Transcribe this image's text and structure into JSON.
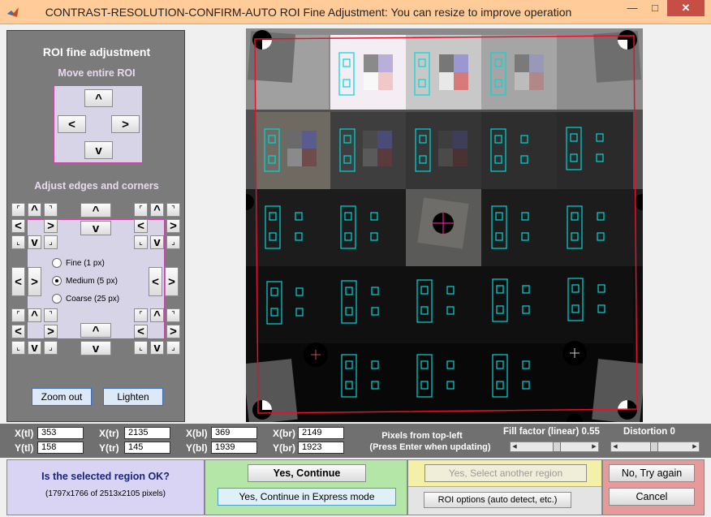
{
  "window": {
    "title": "CONTRAST-RESOLUTION-CONFIRM-AUTO ROI Fine Adjustment: You can resize to improve operation",
    "minimize": "—",
    "maximize": "□",
    "close": "✕"
  },
  "panel": {
    "title": "ROI fine adjustment",
    "move_label": "Move entire ROI",
    "adjust_label": "Adjust edges and corners",
    "radio": [
      {
        "label": "Fine (1 px)",
        "selected": false
      },
      {
        "label": "Medium (5 px)",
        "selected": true
      },
      {
        "label": "Coarse (25 px)",
        "selected": false
      }
    ],
    "zoom_out": "Zoom out",
    "lighten": "Lighten"
  },
  "icons": {
    "up": "^",
    "down": "v",
    "left": "<",
    "right": ">",
    "corner_tl": "⌜",
    "corner_tr": "⌝",
    "corner_bl": "⌞",
    "corner_br": "⌟"
  },
  "coords": {
    "xtl_label": "X(tl)",
    "xtl": "353",
    "ytl_label": "Y(tl)",
    "ytl": "158",
    "xtr_label": "X(tr)",
    "xtr": "2135",
    "ytr_label": "Y(tr)",
    "ytr": "145",
    "xbl_label": "X(bl)",
    "xbl": "369",
    "ybl_label": "Y(bl)",
    "ybl": "1939",
    "xbr_label": "X(br)",
    "xbr": "2149",
    "ybr_label": "Y(br)",
    "ybr": "1923"
  },
  "pixels_note": {
    "line1": "Pixels from top-left",
    "line2": "(Press Enter when updating)"
  },
  "fill": {
    "label": "Fill factor (linear) 0.55",
    "value": 0.55
  },
  "distortion": {
    "label": "Distortion 0",
    "value": 0
  },
  "question": {
    "title": "Is the selected region OK?",
    "detail": "(1797x1766 of 2513x2105 pixels)"
  },
  "buttons": {
    "yes_continue": "Yes, Continue",
    "yes_express": "Yes, Continue in Express mode",
    "yes_select": "Yes, Select another region",
    "roi_options": "ROI options (auto detect, etc.)",
    "no_try": "No, Try again",
    "cancel": "Cancel"
  },
  "colors": {
    "titlebar": "#ffcc99",
    "roi": "#e8102a",
    "fiducial": "#00e0e0",
    "panel": "#7b7b7b"
  }
}
